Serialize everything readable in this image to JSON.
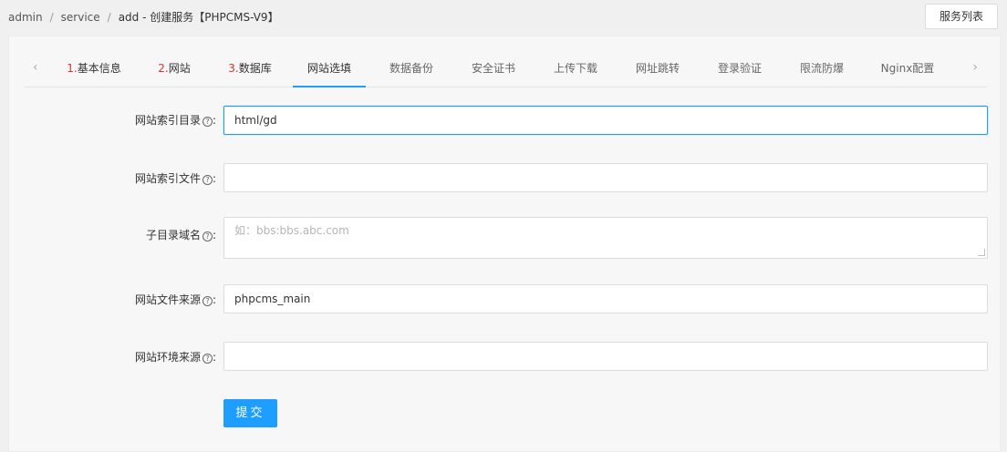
{
  "breadcrumb": {
    "items": [
      "admin",
      "service",
      "add"
    ],
    "current": "创建服务【PHPCMS-V9】"
  },
  "header": {
    "service_list_label": "服务列表"
  },
  "tabs": {
    "prev_arrow": "‹",
    "next_arrow": "›",
    "items": [
      {
        "num": "1.",
        "label": "基本信息"
      },
      {
        "num": "2.",
        "label": "网站"
      },
      {
        "num": "3.",
        "label": "数据库"
      },
      {
        "label": "网站选填",
        "active": true
      },
      {
        "label": "数据备份"
      },
      {
        "label": "安全证书"
      },
      {
        "label": "上传下载"
      },
      {
        "label": "网址跳转"
      },
      {
        "label": "登录验证"
      },
      {
        "label": "限流防爆"
      },
      {
        "label": "Nginx配置"
      }
    ]
  },
  "form": {
    "fields": [
      {
        "label": "网站索引目录",
        "value": "html/gd"
      },
      {
        "label": "网站索引文件",
        "value": ""
      },
      {
        "label": "子目录域名",
        "value": "",
        "placeholder": "如：bbs:bbs.abc.com"
      },
      {
        "label": "网站文件来源",
        "value": "phpcms_main"
      },
      {
        "label": "网站环境来源",
        "value": ""
      }
    ],
    "help_glyph": "?",
    "colon": ":",
    "submit_label": "提交"
  },
  "colors": {
    "accent": "#1e9fff",
    "step_number": "#d9342b"
  }
}
